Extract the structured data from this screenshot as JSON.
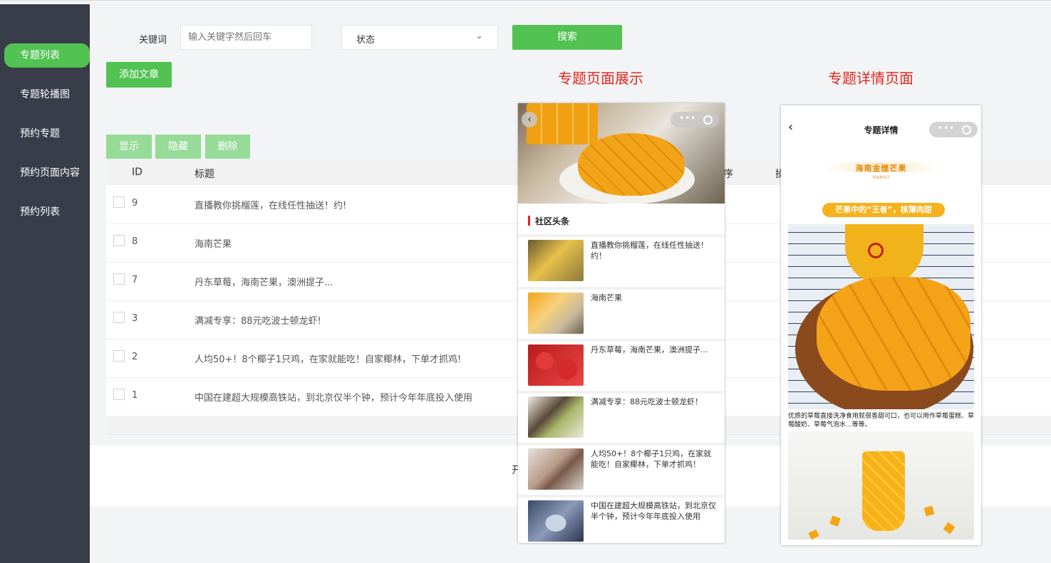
{
  "sidebar": {
    "items": [
      {
        "label": "专题列表",
        "active": true
      },
      {
        "label": "专题轮播图"
      },
      {
        "label": "预约专题"
      },
      {
        "label": "预约页面内容"
      },
      {
        "label": "预约列表"
      }
    ]
  },
  "search": {
    "keyword_label": "关键词",
    "keyword_placeholder": "输入关键字然后回车",
    "status_label": "状态",
    "search_button": "搜索"
  },
  "toolbar": {
    "add_button": "添加文章",
    "show_button": "显示",
    "hide_button": "隐藏",
    "delete_button": "删除"
  },
  "table": {
    "col_id": "ID",
    "col_title": "标题",
    "col_sort_partial": "序",
    "col_action_partial": "操",
    "rows": [
      {
        "id": "9",
        "title": "直播教你挑榴莲，在线任性抽送！约!"
      },
      {
        "id": "8",
        "title": "海南芒果"
      },
      {
        "id": "7",
        "title": "丹东草莓，海南芒果，澳洲提子..."
      },
      {
        "id": "3",
        "title": "满减专享：88元吃波士顿龙虾!"
      },
      {
        "id": "2",
        "title": "人均50+！8个椰子1只鸡，在家就能吃！自家椰林，下单才抓鸡!"
      },
      {
        "id": "1",
        "title": "中国在建超大规模高铁站，到北京仅半个钟，预计今年年底投入使用"
      }
    ]
  },
  "pager_partial": "开",
  "annotations": {
    "list_page": "专题页面展示",
    "detail_page": "专题详情页面"
  },
  "phone_list": {
    "section_title": "社区头条",
    "items": [
      {
        "text": "直播教你挑榴莲，在线任性抽送！约！"
      },
      {
        "text": "海南芒果"
      },
      {
        "text": "丹东草莓，海南芒果，澳洲提子..."
      },
      {
        "text": "满减专享：88元吃波士顿龙虾！"
      },
      {
        "text": "人均50+！8个椰子1只鸡，在家就能吃！自家椰林，下单才抓鸡！"
      },
      {
        "text": "中国在建超大规模高铁站，到北京仅半个钟，预计今年年底投入使用"
      }
    ]
  },
  "phone_detail": {
    "nav_title": "专题详情",
    "banner_title": "海南金煌芒果",
    "banner_sub": "MANGO",
    "tag": "芒果中的“王者”，核薄肉甜",
    "description": "优质的草莓直接洗净食用就很香甜可口，也可以用作草莓蛋糕、草莓酸奶、草莓气泡水...等等。"
  },
  "colors": {
    "sidebar_bg": "#393d49",
    "accent_green": "#52c253",
    "annotation_red": "#e4261d"
  }
}
